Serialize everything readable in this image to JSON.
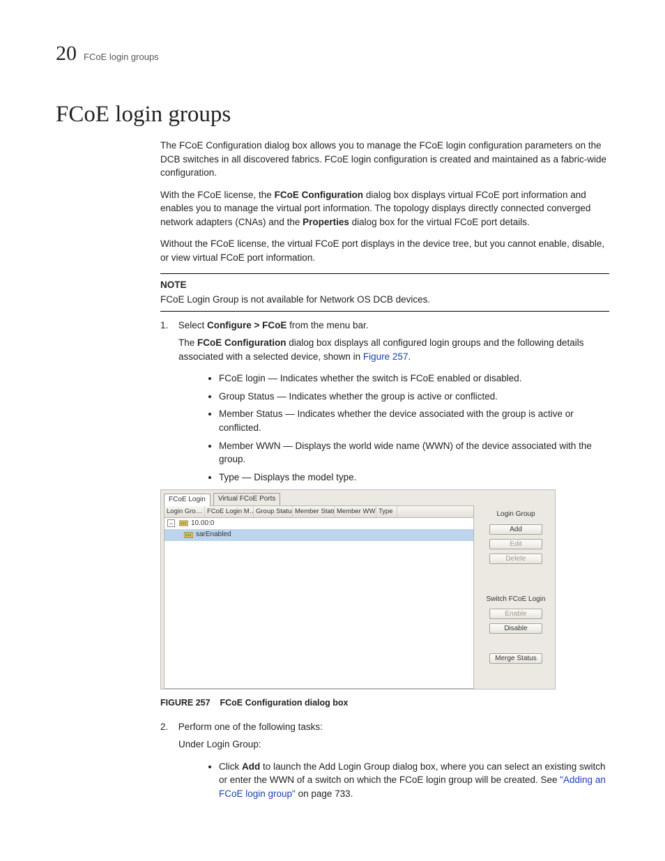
{
  "header": {
    "chapter_number": "20",
    "running_title": "FCoE login groups"
  },
  "title": "FCoE login groups",
  "intro": {
    "p1": "The FCoE Configuration dialog box allows you to manage the FCoE login configuration parameters on the DCB switches in all discovered fabrics. FCoE login configuration is created and maintained as a fabric-wide configuration.",
    "p2_a": "With the FCoE license, the ",
    "p2_b": "FCoE Configuration",
    "p2_c": " dialog box displays virtual FCoE port information and enables you to manage the virtual port information. The topology displays directly connected converged network adapters (CNAs) and the ",
    "p2_d": "Properties",
    "p2_e": " dialog box for the virtual FCoE port details.",
    "p3": "Without the FCoE license, the virtual FCoE port displays in the device tree, but you cannot enable, disable, or view virtual FCoE port information."
  },
  "note": {
    "head": "NOTE",
    "body": "FCoE Login Group is not available for Network OS DCB devices."
  },
  "step1": {
    "num": "1.",
    "text_a": "Select ",
    "text_b": "Configure > FCoE",
    "text_c": " from the menu bar.",
    "sub_a": "The ",
    "sub_b": "FCoE Configuration",
    "sub_c": " dialog box displays all configured login groups and the following details associated with a selected device, shown in ",
    "sub_link": "Figure 257",
    "sub_d": "."
  },
  "bullets": {
    "b1": "FCoE login — Indicates whether the switch is FCoE enabled or disabled.",
    "b2": "Group Status — Indicates whether the group is active or conflicted.",
    "b3": "Member Status — Indicates whether the device associated with the group is active or conflicted.",
    "b4": "Member WWN — Displays the world wide name (WWN) of the device associated with the group.",
    "b5": "Type — Displays the model type."
  },
  "dialog": {
    "tabs": {
      "active": "FCoE Login",
      "inactive": "Virtual FCoE Ports"
    },
    "columns": {
      "c1": "Login Gro… ▲",
      "c2": "FCoE Login M…",
      "c3": "Group Status",
      "c4": "Member Status",
      "c5": "Member WWN",
      "c6": "Type"
    },
    "rows": {
      "root_expander": "−",
      "root_label": "10.00:0",
      "child_label": "sarEnabled"
    },
    "side": {
      "grp_label": "Login Group",
      "add": "Add",
      "edit": "Edit",
      "delete": "Delete",
      "sw_label": "Switch FCoE Login",
      "enable": "Enable",
      "disable": "Disable",
      "merge": "Merge Status"
    }
  },
  "figcap": {
    "label": "FIGURE 257",
    "text": "FCoE Configuration dialog box"
  },
  "step2": {
    "num": "2.",
    "text": "Perform one of the following tasks:",
    "sub": "Under Login Group:",
    "bullet_a": "Click ",
    "bullet_b": "Add",
    "bullet_c": " to launch the Add Login Group dialog box, where you can select an existing switch or enter the WWN of a switch on which the FCoE login group will be created. See ",
    "bullet_link": "\"Adding an FCoE login group\"",
    "bullet_d": " on page 733."
  }
}
